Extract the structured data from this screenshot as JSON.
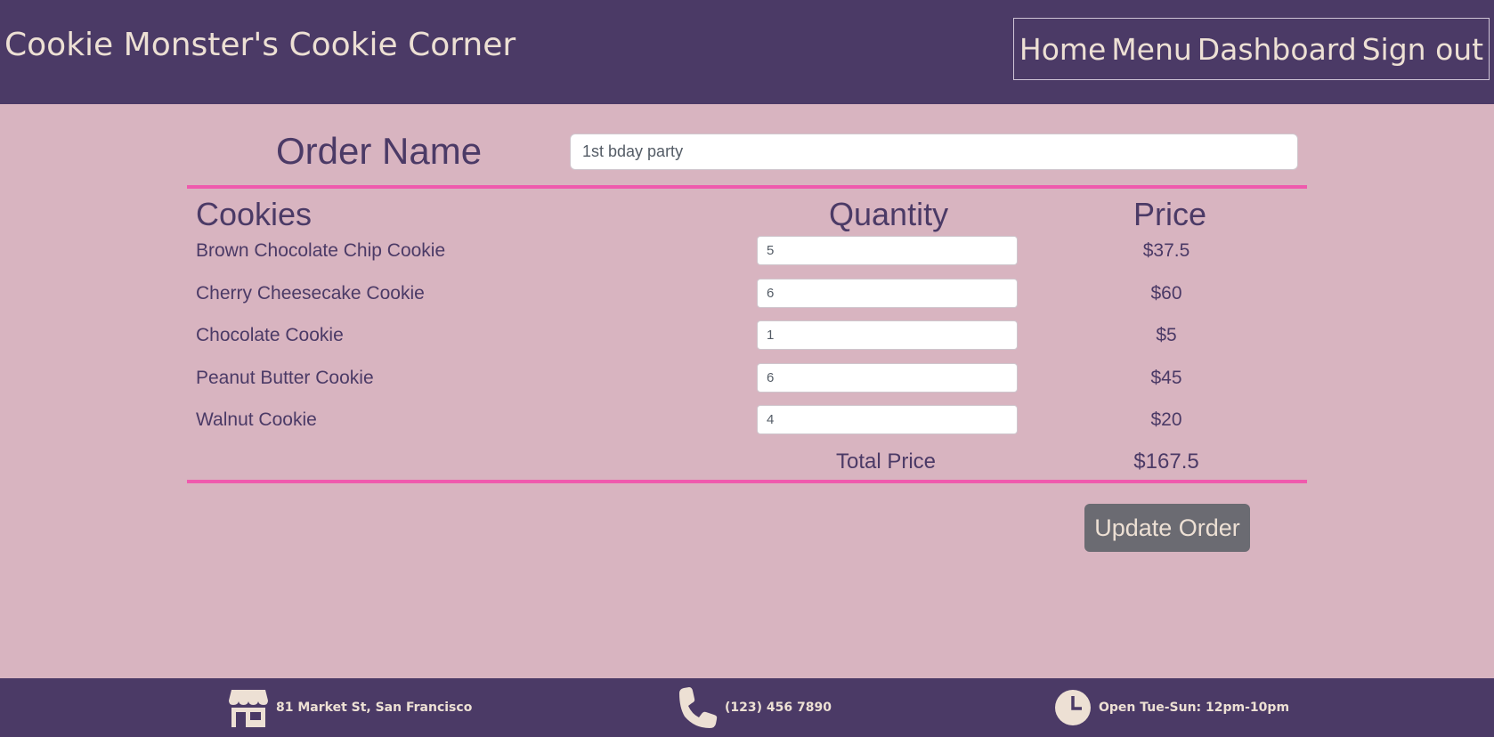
{
  "header": {
    "title": "Cookie Monster's Cookie Corner",
    "nav": [
      "Home",
      "Menu",
      "Dashboard",
      "Sign out"
    ]
  },
  "order": {
    "name_label": "Order Name",
    "name_value": "1st bday party"
  },
  "table": {
    "headers": {
      "cookies": "Cookies",
      "quantity": "Quantity",
      "price": "Price"
    },
    "rows": [
      {
        "name": "Brown Chocolate Chip Cookie",
        "quantity": "5",
        "price": "$37.5"
      },
      {
        "name": "Cherry Cheesecake Cookie",
        "quantity": "6",
        "price": "$60"
      },
      {
        "name": "Chocolate Cookie",
        "quantity": "1",
        "price": "$5"
      },
      {
        "name": "Peanut Butter Cookie",
        "quantity": "6",
        "price": "$45"
      },
      {
        "name": "Walnut Cookie",
        "quantity": "4",
        "price": "$20"
      }
    ],
    "total_label": "Total Price",
    "total_value": "$167.5"
  },
  "actions": {
    "update_label": "Update Order"
  },
  "footer": {
    "address": {
      "icon": "store-icon",
      "text": "81 Market St, San Francisco"
    },
    "phone": {
      "icon": "phone-icon",
      "text": "(123) 456 7890"
    },
    "hours": {
      "icon": "clock-icon",
      "text": "Open Tue-Sun: 12pm-10pm"
    }
  },
  "colors": {
    "header_bg": "#4b3a66",
    "page_bg": "#d8b4c0",
    "accent_rule": "#ef5aad",
    "text": "#4b3a66",
    "light_text": "#ede0d4",
    "button_bg": "#6b6b72"
  }
}
